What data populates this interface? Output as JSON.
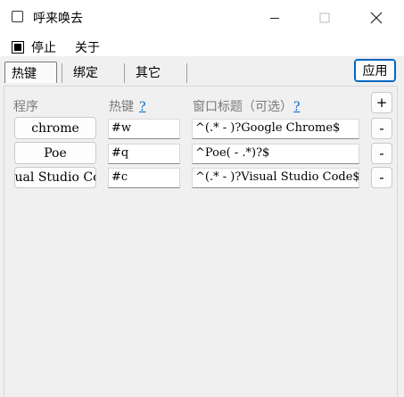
{
  "window": {
    "title": "呼来唤去"
  },
  "menu": {
    "stop_label": "停止",
    "about_label": "关于"
  },
  "tabs": [
    "热键",
    "绑定",
    "其它"
  ],
  "apply_label": "应用",
  "columns": {
    "program": "程序",
    "hotkey": "热键",
    "window_title": "窗口标题（可选）",
    "help": "?"
  },
  "add_label": "+",
  "remove_label": "-",
  "rows": [
    {
      "program": "chrome",
      "hotkey": "#w",
      "title": "^(.* - )?Google Chrome$"
    },
    {
      "program": "Poe",
      "hotkey": "#q",
      "title": "^Poe( - .*)?$"
    },
    {
      "program": "Visual Studio Code",
      "hotkey": "#c",
      "title": "^(.* - )?Visual Studio Code$"
    }
  ]
}
